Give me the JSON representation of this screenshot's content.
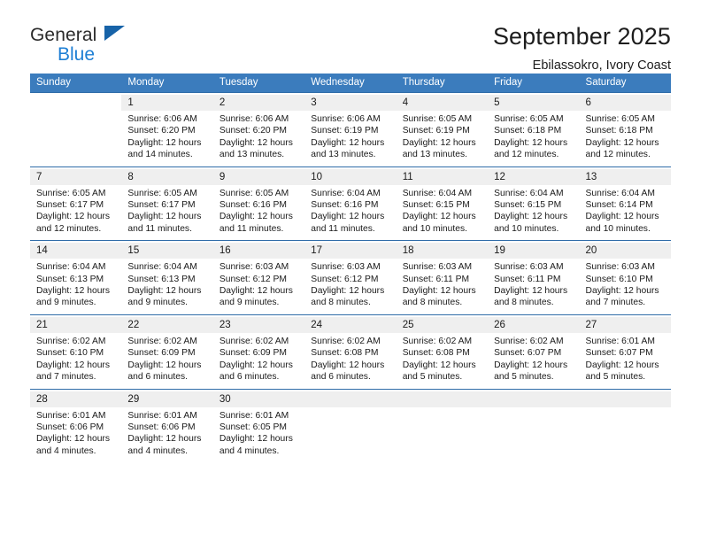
{
  "brand": {
    "name_top": "General",
    "name_bottom": "Blue",
    "accent_color": "#1763a8",
    "blue_text_color": "#1e7fd4"
  },
  "header": {
    "title": "September 2025",
    "subtitle": "Ebilassokro, Ivory Coast"
  },
  "theme": {
    "header_row_bg": "#3b7cbd",
    "daynum_bg": "#efefef",
    "separator_color": "#2f6ca8",
    "body_bg": "#ffffff"
  },
  "weekdays": [
    "Sunday",
    "Monday",
    "Tuesday",
    "Wednesday",
    "Thursday",
    "Friday",
    "Saturday"
  ],
  "weeks": [
    [
      {
        "day": "",
        "sunrise": "",
        "sunset": "",
        "daylight_line1": "",
        "daylight_line2": ""
      },
      {
        "day": "1",
        "sunrise": "Sunrise: 6:06 AM",
        "sunset": "Sunset: 6:20 PM",
        "daylight_line1": "Daylight: 12 hours",
        "daylight_line2": "and 14 minutes."
      },
      {
        "day": "2",
        "sunrise": "Sunrise: 6:06 AM",
        "sunset": "Sunset: 6:20 PM",
        "daylight_line1": "Daylight: 12 hours",
        "daylight_line2": "and 13 minutes."
      },
      {
        "day": "3",
        "sunrise": "Sunrise: 6:06 AM",
        "sunset": "Sunset: 6:19 PM",
        "daylight_line1": "Daylight: 12 hours",
        "daylight_line2": "and 13 minutes."
      },
      {
        "day": "4",
        "sunrise": "Sunrise: 6:05 AM",
        "sunset": "Sunset: 6:19 PM",
        "daylight_line1": "Daylight: 12 hours",
        "daylight_line2": "and 13 minutes."
      },
      {
        "day": "5",
        "sunrise": "Sunrise: 6:05 AM",
        "sunset": "Sunset: 6:18 PM",
        "daylight_line1": "Daylight: 12 hours",
        "daylight_line2": "and 12 minutes."
      },
      {
        "day": "6",
        "sunrise": "Sunrise: 6:05 AM",
        "sunset": "Sunset: 6:18 PM",
        "daylight_line1": "Daylight: 12 hours",
        "daylight_line2": "and 12 minutes."
      }
    ],
    [
      {
        "day": "7",
        "sunrise": "Sunrise: 6:05 AM",
        "sunset": "Sunset: 6:17 PM",
        "daylight_line1": "Daylight: 12 hours",
        "daylight_line2": "and 12 minutes."
      },
      {
        "day": "8",
        "sunrise": "Sunrise: 6:05 AM",
        "sunset": "Sunset: 6:17 PM",
        "daylight_line1": "Daylight: 12 hours",
        "daylight_line2": "and 11 minutes."
      },
      {
        "day": "9",
        "sunrise": "Sunrise: 6:05 AM",
        "sunset": "Sunset: 6:16 PM",
        "daylight_line1": "Daylight: 12 hours",
        "daylight_line2": "and 11 minutes."
      },
      {
        "day": "10",
        "sunrise": "Sunrise: 6:04 AM",
        "sunset": "Sunset: 6:16 PM",
        "daylight_line1": "Daylight: 12 hours",
        "daylight_line2": "and 11 minutes."
      },
      {
        "day": "11",
        "sunrise": "Sunrise: 6:04 AM",
        "sunset": "Sunset: 6:15 PM",
        "daylight_line1": "Daylight: 12 hours",
        "daylight_line2": "and 10 minutes."
      },
      {
        "day": "12",
        "sunrise": "Sunrise: 6:04 AM",
        "sunset": "Sunset: 6:15 PM",
        "daylight_line1": "Daylight: 12 hours",
        "daylight_line2": "and 10 minutes."
      },
      {
        "day": "13",
        "sunrise": "Sunrise: 6:04 AM",
        "sunset": "Sunset: 6:14 PM",
        "daylight_line1": "Daylight: 12 hours",
        "daylight_line2": "and 10 minutes."
      }
    ],
    [
      {
        "day": "14",
        "sunrise": "Sunrise: 6:04 AM",
        "sunset": "Sunset: 6:13 PM",
        "daylight_line1": "Daylight: 12 hours",
        "daylight_line2": "and 9 minutes."
      },
      {
        "day": "15",
        "sunrise": "Sunrise: 6:04 AM",
        "sunset": "Sunset: 6:13 PM",
        "daylight_line1": "Daylight: 12 hours",
        "daylight_line2": "and 9 minutes."
      },
      {
        "day": "16",
        "sunrise": "Sunrise: 6:03 AM",
        "sunset": "Sunset: 6:12 PM",
        "daylight_line1": "Daylight: 12 hours",
        "daylight_line2": "and 9 minutes."
      },
      {
        "day": "17",
        "sunrise": "Sunrise: 6:03 AM",
        "sunset": "Sunset: 6:12 PM",
        "daylight_line1": "Daylight: 12 hours",
        "daylight_line2": "and 8 minutes."
      },
      {
        "day": "18",
        "sunrise": "Sunrise: 6:03 AM",
        "sunset": "Sunset: 6:11 PM",
        "daylight_line1": "Daylight: 12 hours",
        "daylight_line2": "and 8 minutes."
      },
      {
        "day": "19",
        "sunrise": "Sunrise: 6:03 AM",
        "sunset": "Sunset: 6:11 PM",
        "daylight_line1": "Daylight: 12 hours",
        "daylight_line2": "and 8 minutes."
      },
      {
        "day": "20",
        "sunrise": "Sunrise: 6:03 AM",
        "sunset": "Sunset: 6:10 PM",
        "daylight_line1": "Daylight: 12 hours",
        "daylight_line2": "and 7 minutes."
      }
    ],
    [
      {
        "day": "21",
        "sunrise": "Sunrise: 6:02 AM",
        "sunset": "Sunset: 6:10 PM",
        "daylight_line1": "Daylight: 12 hours",
        "daylight_line2": "and 7 minutes."
      },
      {
        "day": "22",
        "sunrise": "Sunrise: 6:02 AM",
        "sunset": "Sunset: 6:09 PM",
        "daylight_line1": "Daylight: 12 hours",
        "daylight_line2": "and 6 minutes."
      },
      {
        "day": "23",
        "sunrise": "Sunrise: 6:02 AM",
        "sunset": "Sunset: 6:09 PM",
        "daylight_line1": "Daylight: 12 hours",
        "daylight_line2": "and 6 minutes."
      },
      {
        "day": "24",
        "sunrise": "Sunrise: 6:02 AM",
        "sunset": "Sunset: 6:08 PM",
        "daylight_line1": "Daylight: 12 hours",
        "daylight_line2": "and 6 minutes."
      },
      {
        "day": "25",
        "sunrise": "Sunrise: 6:02 AM",
        "sunset": "Sunset: 6:08 PM",
        "daylight_line1": "Daylight: 12 hours",
        "daylight_line2": "and 5 minutes."
      },
      {
        "day": "26",
        "sunrise": "Sunrise: 6:02 AM",
        "sunset": "Sunset: 6:07 PM",
        "daylight_line1": "Daylight: 12 hours",
        "daylight_line2": "and 5 minutes."
      },
      {
        "day": "27",
        "sunrise": "Sunrise: 6:01 AM",
        "sunset": "Sunset: 6:07 PM",
        "daylight_line1": "Daylight: 12 hours",
        "daylight_line2": "and 5 minutes."
      }
    ],
    [
      {
        "day": "28",
        "sunrise": "Sunrise: 6:01 AM",
        "sunset": "Sunset: 6:06 PM",
        "daylight_line1": "Daylight: 12 hours",
        "daylight_line2": "and 4 minutes."
      },
      {
        "day": "29",
        "sunrise": "Sunrise: 6:01 AM",
        "sunset": "Sunset: 6:06 PM",
        "daylight_line1": "Daylight: 12 hours",
        "daylight_line2": "and 4 minutes."
      },
      {
        "day": "30",
        "sunrise": "Sunrise: 6:01 AM",
        "sunset": "Sunset: 6:05 PM",
        "daylight_line1": "Daylight: 12 hours",
        "daylight_line2": "and 4 minutes."
      },
      {
        "day": "",
        "sunrise": "",
        "sunset": "",
        "daylight_line1": "",
        "daylight_line2": ""
      },
      {
        "day": "",
        "sunrise": "",
        "sunset": "",
        "daylight_line1": "",
        "daylight_line2": ""
      },
      {
        "day": "",
        "sunrise": "",
        "sunset": "",
        "daylight_line1": "",
        "daylight_line2": ""
      },
      {
        "day": "",
        "sunrise": "",
        "sunset": "",
        "daylight_line1": "",
        "daylight_line2": ""
      }
    ]
  ]
}
